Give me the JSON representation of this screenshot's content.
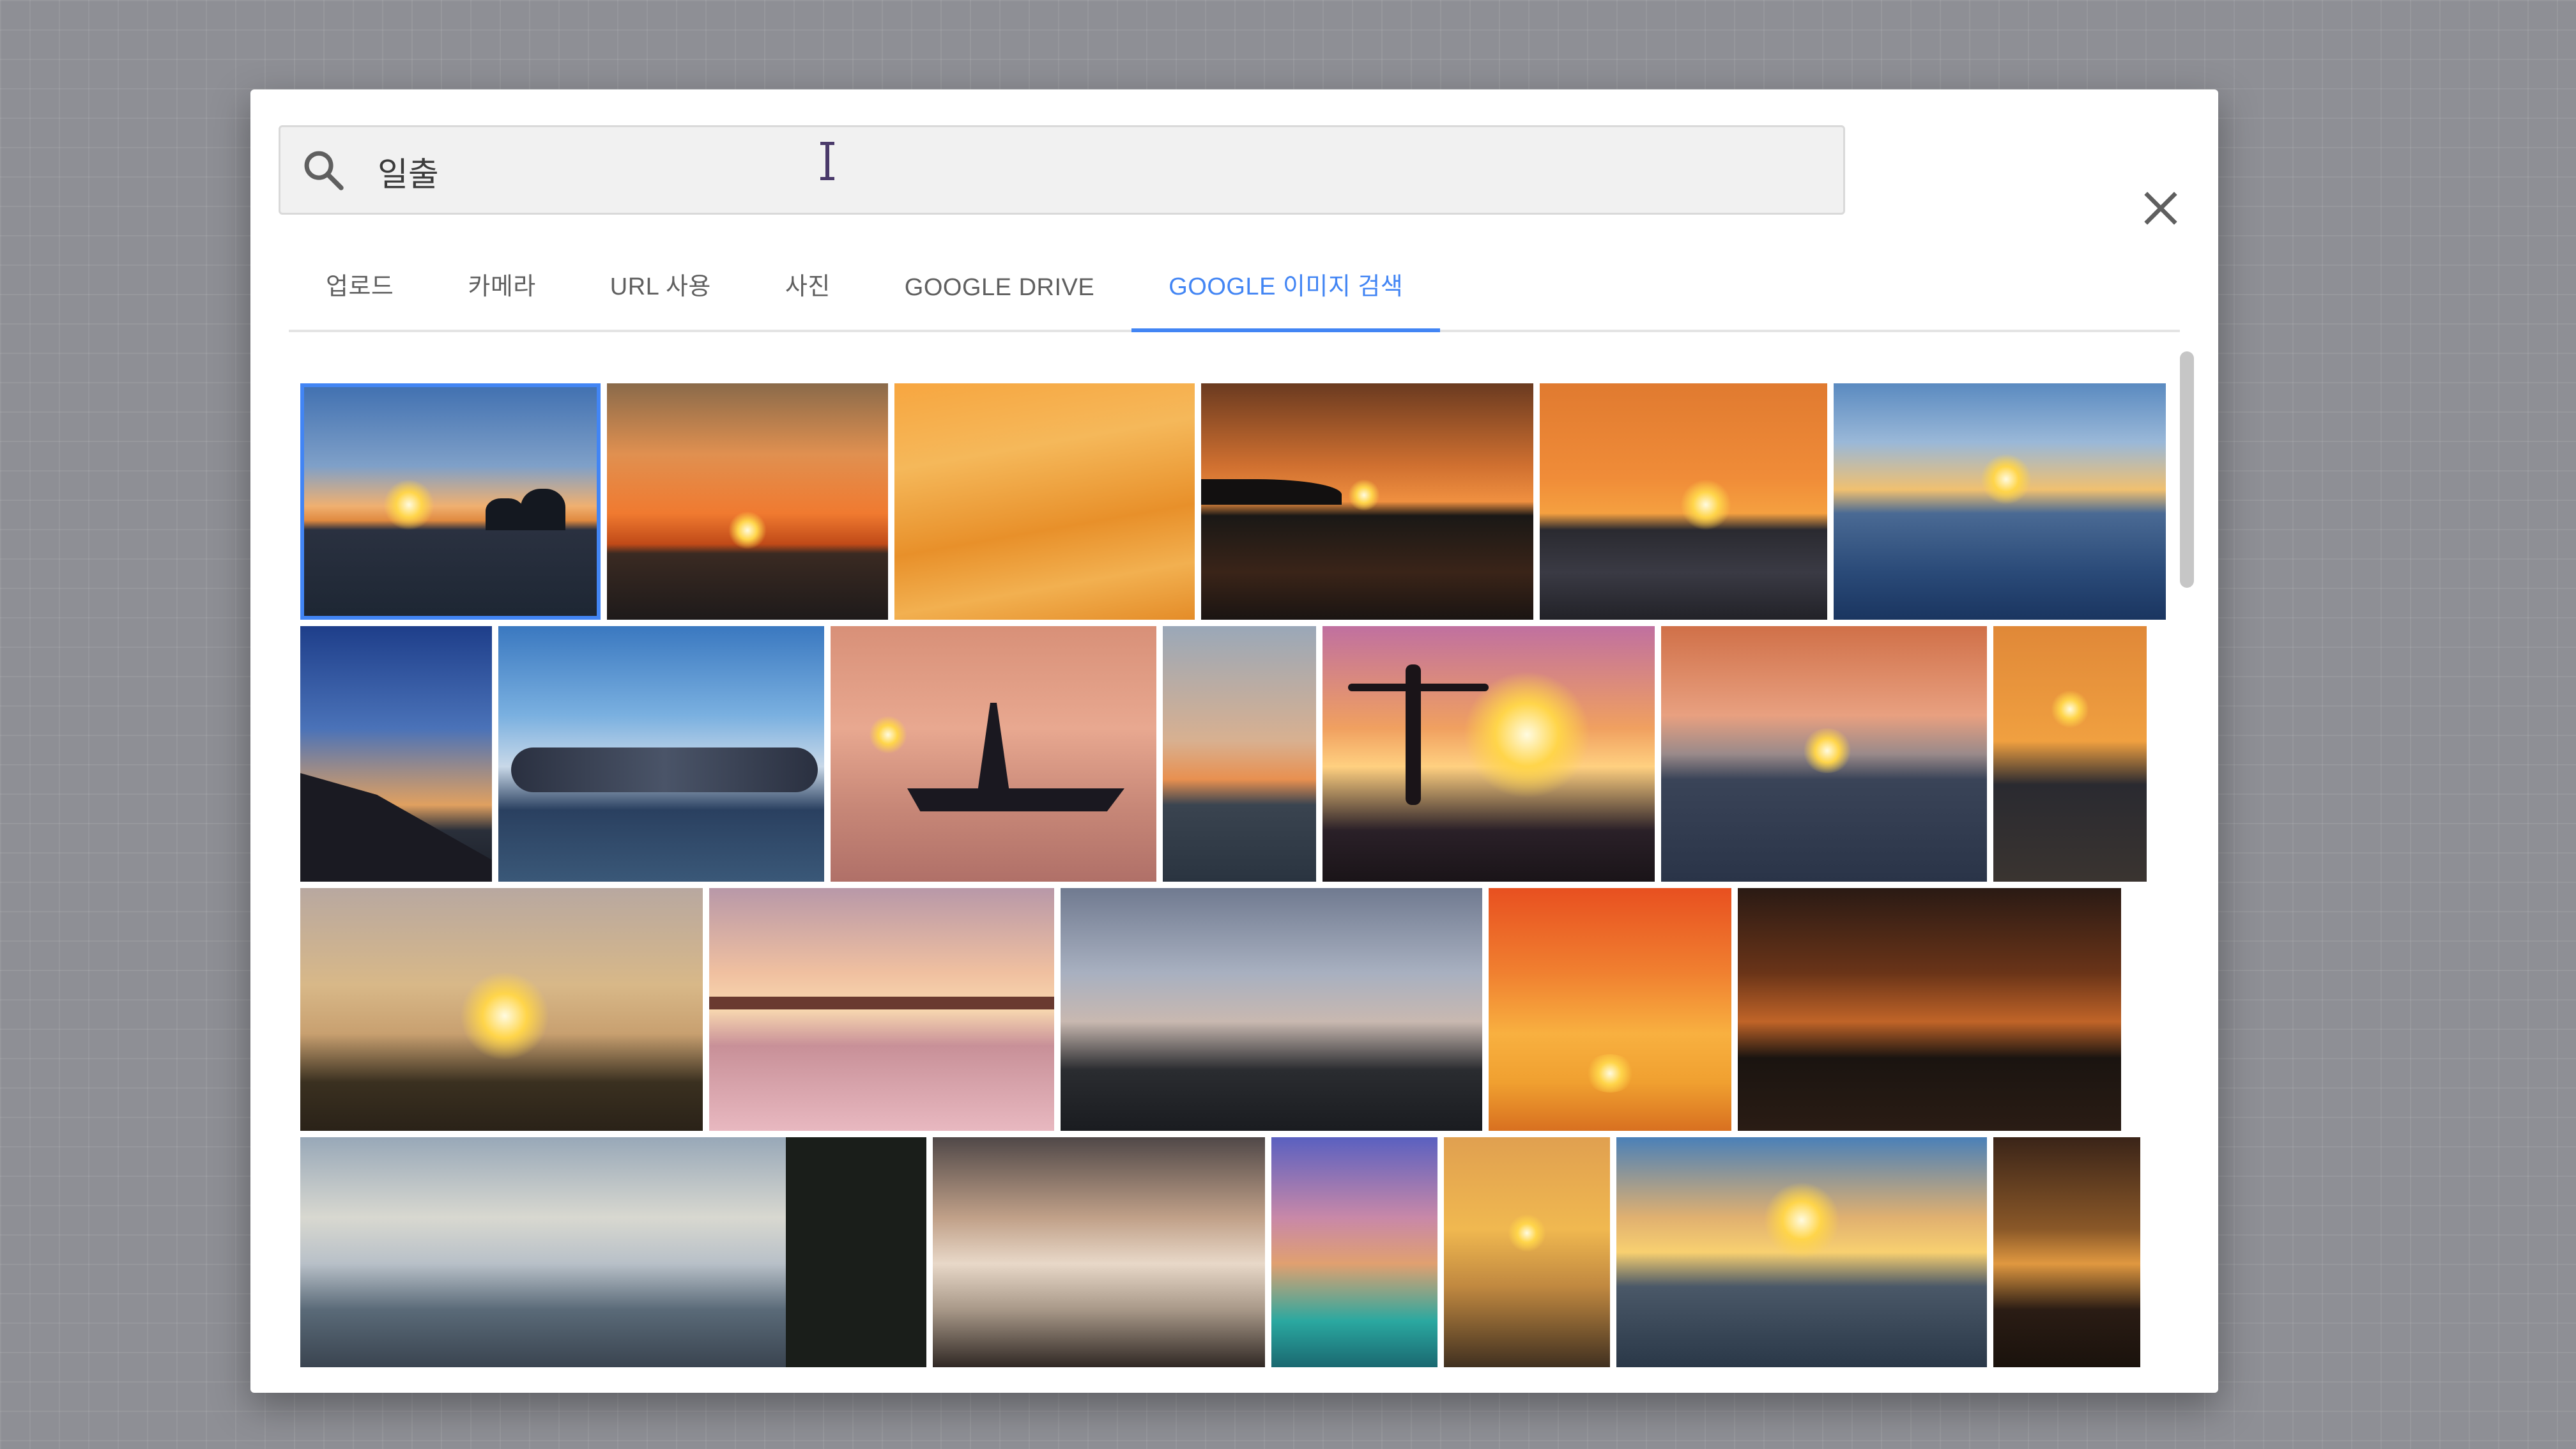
{
  "search": {
    "query": "일출"
  },
  "tabs": [
    {
      "label": "업로드",
      "active": false
    },
    {
      "label": "카메라",
      "active": false
    },
    {
      "label": "URL 사용",
      "active": false
    },
    {
      "label": "사진",
      "active": false
    },
    {
      "label": "GOOGLE DRIVE",
      "active": false
    },
    {
      "label": "GOOGLE 이미지 검색",
      "active": true
    }
  ],
  "colors": {
    "accent": "#4285f4",
    "tab_text": "#5f5f5f"
  },
  "icons": {
    "search": "search-icon",
    "close": "close-icon"
  },
  "results": {
    "rows": [
      {
        "thumbs": [
          {
            "name": "sunset-sea-rocks",
            "selected": true
          },
          {
            "name": "sunset-orange-sea"
          },
          {
            "name": "sunset-birds-sky"
          },
          {
            "name": "sunset-coast-tree"
          },
          {
            "name": "sunset-rocks-sun"
          },
          {
            "name": "sunset-blue-sea"
          }
        ]
      },
      {
        "thumbs": [
          {
            "name": "sunset-cliff-blue"
          },
          {
            "name": "sunset-clouds-sea"
          },
          {
            "name": "sunset-warship"
          },
          {
            "name": "sunset-small-sea"
          },
          {
            "name": "sunset-person-pier"
          },
          {
            "name": "sunset-red-horizon"
          },
          {
            "name": "sunset-orange-glow"
          }
        ]
      },
      {
        "thumbs": [
          {
            "name": "sunrise-grass"
          },
          {
            "name": "sunrise-pier-pink"
          },
          {
            "name": "sunrise-hills-clouds"
          },
          {
            "name": "sunrise-orange-clouds"
          },
          {
            "name": "sunrise-dark-island"
          }
        ]
      },
      {
        "thumbs": [
          {
            "name": "sunrise-misty-coast"
          },
          {
            "name": "sunrise-cloud-sea"
          },
          {
            "name": "sunrise-sailing-ship"
          },
          {
            "name": "sunrise-golden-sun"
          },
          {
            "name": "sunrise-bright-sea"
          },
          {
            "name": "sunrise-dark-shore"
          }
        ]
      }
    ]
  }
}
